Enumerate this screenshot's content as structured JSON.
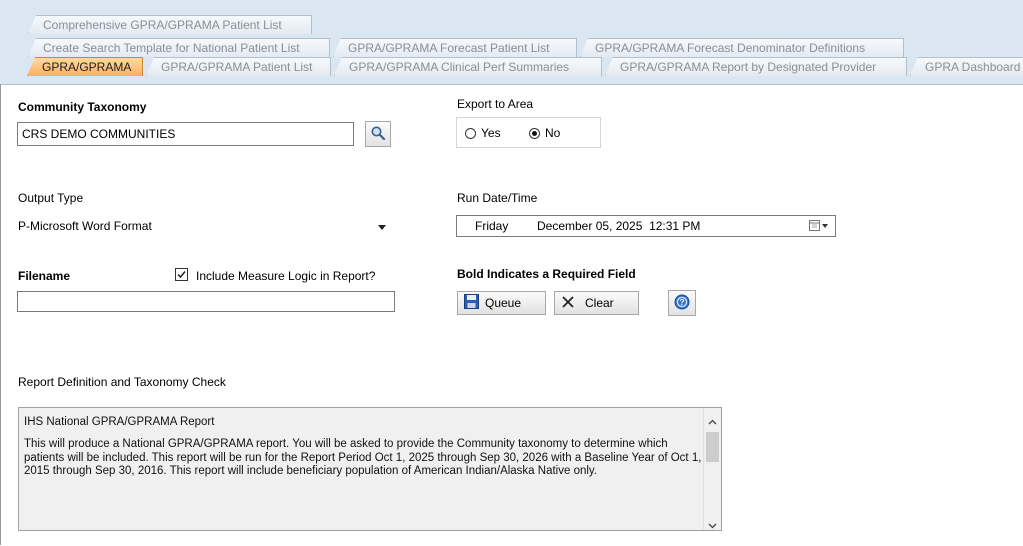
{
  "tabs": {
    "row1": [
      "Comprehensive GPRA/GPRAMA Patient List"
    ],
    "row2": [
      "Create Search Template for National Patient List",
      "GPRA/GPRAMA Forecast Patient List",
      "GPRA/GPRAMA Forecast Denominator Definitions"
    ],
    "row3": [
      "GPRA/GPRAMA",
      "GPRA/GPRAMA Patient List",
      "GPRA/GPRAMA Clinical Perf Summaries",
      "GPRA/GPRAMA Report by Designated Provider",
      "GPRA Dashboard"
    ],
    "active": "GPRA/GPRAMA"
  },
  "form": {
    "community_label": "Community Taxonomy",
    "community_value": "CRS DEMO COMMUNITIES",
    "export_label": "Export to Area",
    "export_yes": "Yes",
    "export_no": "No",
    "export_selected": "No",
    "output_label": "Output Type",
    "output_value": "P-Microsoft Word Format",
    "rundate_label": "Run Date/Time",
    "rundate_day": "Friday",
    "rundate_date": "December 05, 2025  12:31 PM",
    "filename_label": "Filename",
    "filename_value": "",
    "include_logic_label": "Include Measure Logic in Report?",
    "include_logic_checked": true,
    "required_note": "Bold Indicates a Required Field",
    "queue_label": "Queue",
    "clear_label": "Clear"
  },
  "report": {
    "section_label": "Report Definition and Taxonomy Check",
    "title": "IHS National GPRA/GPRAMA Report",
    "description": "This will produce a National GPRA/GPRAMA report.  You will be asked to provide the Community taxonomy to determine which patients will be included.  This report will be run for the Report Period Oct 1, 2025 through Sep 30, 2026 with a Baseline Year of Oct 1, 2015 through Sep 30, 2016. This report will include beneficiary population of American Indian/Alaska Native only."
  },
  "colors": {
    "tabstrip_bg": "#dbe6f3",
    "active_tab": "#f8b061",
    "help_icon": "#2f6fd0",
    "save_icon": "#2b5fb5"
  },
  "icons": [
    "search-icon",
    "save-icon",
    "clear-x-icon",
    "help-icon",
    "calendar-icon"
  ]
}
